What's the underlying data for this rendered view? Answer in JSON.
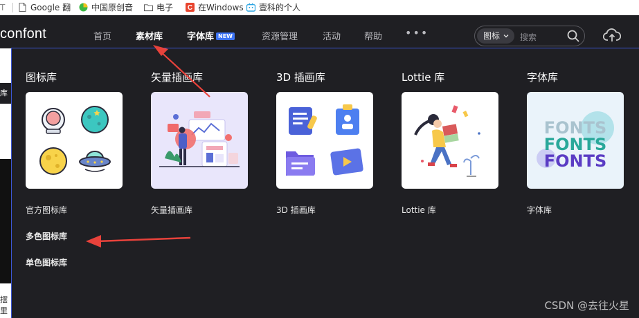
{
  "bookmarks": [
    {
      "label": "T",
      "icon": "partial-icon"
    },
    {
      "label": "Google 翻",
      "icon": "document-icon"
    },
    {
      "label": "中国原创音",
      "icon": "music-leaf-icon"
    },
    {
      "label": "电子",
      "icon": "folder-icon"
    },
    {
      "label": "在Windows",
      "icon": "csdn-c-icon"
    },
    {
      "label": "壹科的个人",
      "icon": "bilibili-icon"
    }
  ],
  "header": {
    "logo": "confont",
    "nav": [
      {
        "label": "首页",
        "active": false
      },
      {
        "label": "素材库",
        "active": true
      },
      {
        "label": "字体库",
        "active": false,
        "badge": "NEW"
      },
      {
        "label": "资源管理",
        "active": false
      },
      {
        "label": "活动",
        "active": false
      },
      {
        "label": "帮助",
        "active": false
      }
    ],
    "more": "•••",
    "search": {
      "category": "图标",
      "placeholder": "搜索"
    }
  },
  "page": {
    "left_tab": "库",
    "left_bottom": "摆里"
  },
  "dropdown": {
    "columns": [
      {
        "title": "图标库",
        "links": [
          "官方图标库",
          "多色图标库",
          "单色图标库"
        ]
      },
      {
        "title": "矢量插画库",
        "links": [
          "矢量插画库"
        ]
      },
      {
        "title": "3D 插画库",
        "links": [
          "3D 插画库"
        ]
      },
      {
        "title": "Lottie 库",
        "links": [
          "Lottie 库"
        ]
      },
      {
        "title": "字体库",
        "links": [
          "字体库"
        ]
      }
    ],
    "fonts_preview": [
      "FONTS",
      "FONTS",
      "FONTS"
    ]
  },
  "watermark": "CSDN @去往火星",
  "colors": {
    "accent": "#3d74f5",
    "panel": "#1f1f23",
    "arrow": "#e8423b"
  }
}
